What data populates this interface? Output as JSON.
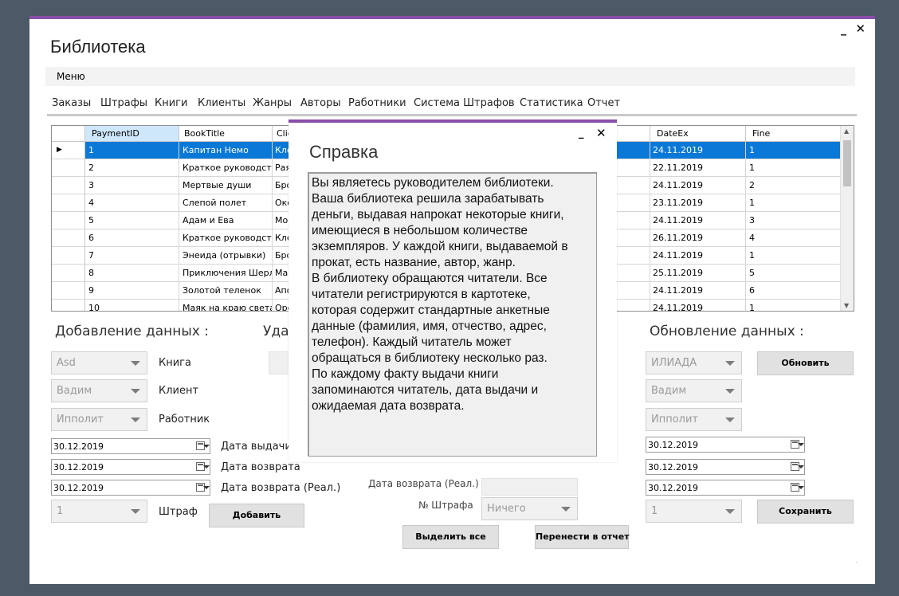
{
  "window": {
    "title": "Библиотека",
    "minimize": "_",
    "close": "✕"
  },
  "menu": {
    "label": "Меню"
  },
  "tabs": [
    "Заказы",
    "Штрафы",
    "Книги",
    "Клиенты",
    "Жанры",
    "Авторы",
    "Работники",
    "Система Штрафов",
    "Статистика",
    "Отчет"
  ],
  "grid": {
    "columns": [
      "PaymentID",
      "BookTitle",
      "Clie",
      "DateEx",
      "Fine"
    ],
    "current_row_marker": "▶",
    "rows": [
      {
        "id": "1",
        "title": "Капитан Немо",
        "client": "Кле",
        "date": "24.11.2019",
        "fine": "1"
      },
      {
        "id": "2",
        "title": "Краткое руководст...",
        "client": "Рая",
        "date": "22.11.2019",
        "fine": "1"
      },
      {
        "id": "3",
        "title": "Мертвые души",
        "client": "Бро",
        "date": "24.11.2019",
        "fine": "2"
      },
      {
        "id": "4",
        "title": "Слепой полет",
        "client": "Окс",
        "date": "23.11.2019",
        "fine": "1"
      },
      {
        "id": "5",
        "title": "Адам и Ева",
        "client": "Мон",
        "date": "24.11.2019",
        "fine": "3"
      },
      {
        "id": "6",
        "title": "Краткое руководст...",
        "client": "Кле",
        "date": "26.11.2019",
        "fine": "4"
      },
      {
        "id": "7",
        "title": "Энеида (отрывки)",
        "client": "Бро",
        "date": "24.11.2019",
        "fine": "1"
      },
      {
        "id": "8",
        "title": "Приключения Шерл...",
        "client": "Мар",
        "date": "25.11.2019",
        "fine": "5"
      },
      {
        "id": "9",
        "title": "Золотой теленок",
        "client": "Апо",
        "date": "24.11.2019",
        "fine": "6"
      },
      {
        "id": "10",
        "title": "Маяк на краю света",
        "client": "Оре",
        "date": "24.11.2019",
        "fine": "1"
      }
    ]
  },
  "add_section": {
    "title": "Добавление данных :",
    "book_combo": "Asd",
    "book_label": "Книга",
    "client_combo": "Вадим",
    "client_label": "Клиент",
    "worker_combo": "Ипполит",
    "worker_label": "Работник",
    "date_issue": "30.12.2019",
    "date_issue_label": "Дата выдачи",
    "date_return": "30.12.2019",
    "date_return_label": "Дата возврата",
    "date_return_real": "30.12.2019",
    "date_return_real_label": "Дата возврата (Реал.)",
    "fine_combo": "1",
    "fine_label": "Штраф",
    "add_button": "Добавить"
  },
  "delete_section": {
    "title": "Удал",
    "date_return_real_label": "Дата возврата (Реал.)",
    "fine_no_label": "№ Штрафа",
    "fine_no_combo": "Ничего",
    "select_all_button": "Выделить все",
    "move_report_button": "Перенести в отчет"
  },
  "update_section": {
    "title": "Обновление данных :",
    "book_combo": "ИЛИАДА",
    "update_button": "Обновить",
    "client_combo": "Вадим",
    "worker_combo": "Ипполит",
    "date1": "30.12.2019",
    "date2": "30.12.2019",
    "date3": "30.12.2019",
    "fine_combo": "1",
    "save_button": "Сохранить"
  },
  "help_dialog": {
    "title": "Справка",
    "minimize": "_",
    "close": "✕",
    "text": "Вы являетесь руководителем библиотеки.\nВаша библиотека решила зарабатывать\nденьги, выдавая напрокат некоторые книги,\nимеющиеся в небольшом количестве\nэкземпляров. У каждой книги, выдаваемой в\nпрокат, есть название, автор, жанр.\nВ библиотеку обращаются читатели. Все\nчитатели регистрируются в картотеке,\nкоторая содержит стандартные анкетные\nданные (фамилия, имя, отчество, адрес,\nтелефон). Каждый читатель может\nобращаться в библиотеку несколько раз.\nПо каждому факту выдачи книги\nзапоминаются читатель, дата выдачи и\nожидаемая дата возврата."
  },
  "colors": {
    "accent": "#8a4ea8",
    "selection": "#0a78d7",
    "background": "#4b5a66"
  }
}
